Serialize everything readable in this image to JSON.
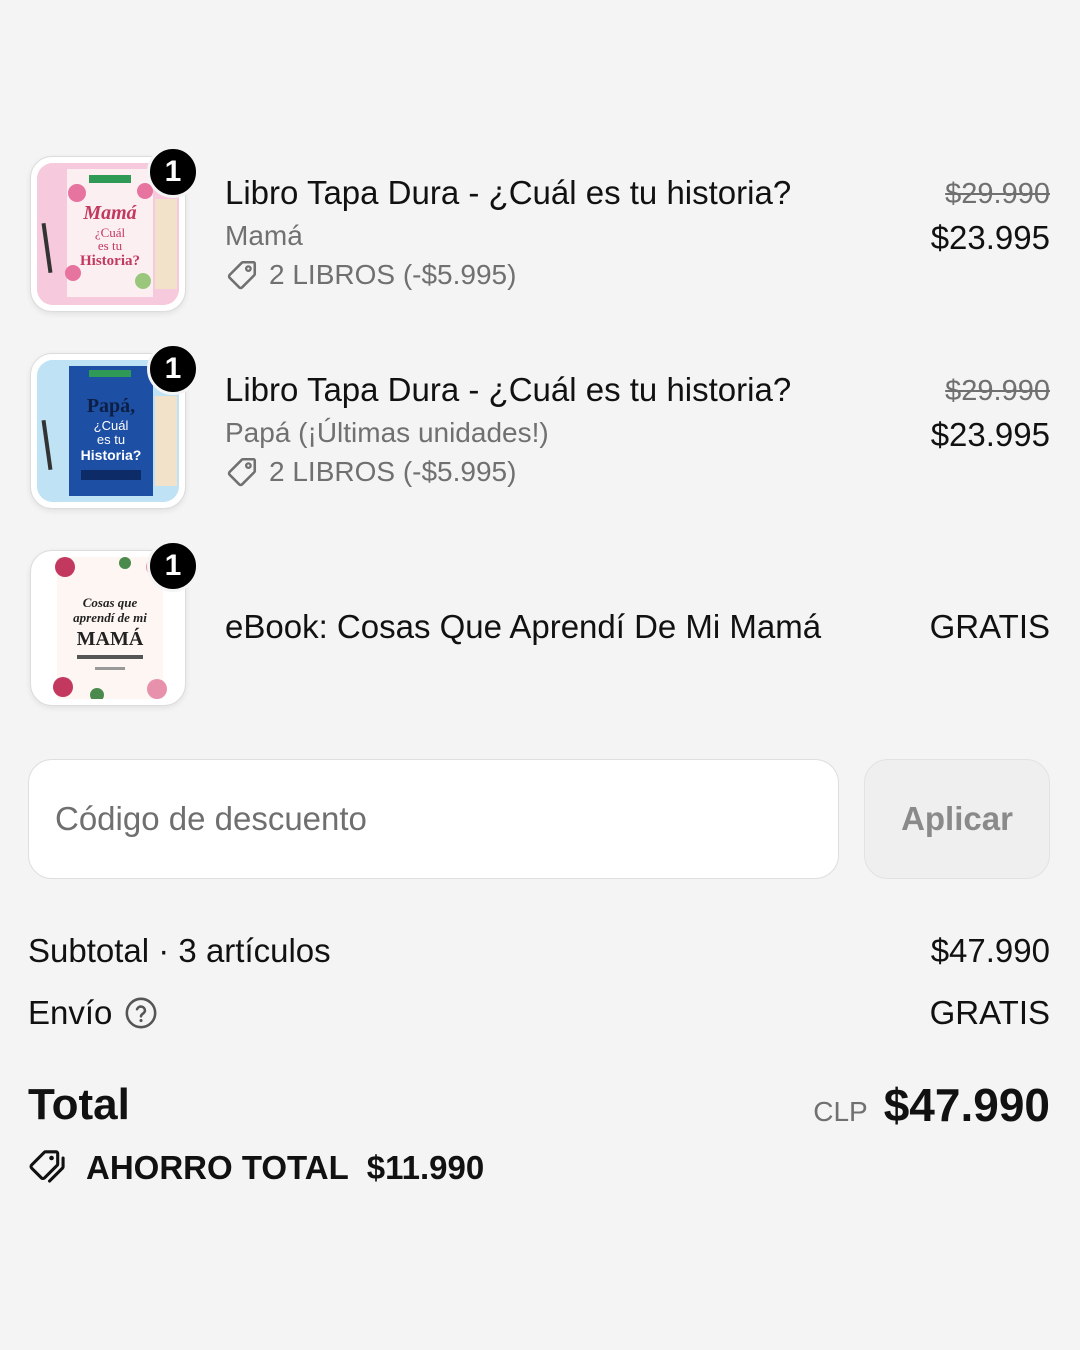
{
  "cart": {
    "items": [
      {
        "quantity": "1",
        "title": "Libro Tapa Dura - ¿Cuál es tu historia?",
        "variant": "Mamá",
        "discount": "2 LIBROS (-$5.995)",
        "price_original": "$29.990",
        "price": "$23.995",
        "thumb_colors": {
          "bg": "#f7c9dc",
          "cover": "#fbeff2",
          "accent": "#d6437f"
        }
      },
      {
        "quantity": "1",
        "title": "Libro Tapa Dura - ¿Cuál es tu historia?",
        "variant": "Papá (¡Últimas unidades!)",
        "discount": "2 LIBROS (-$5.995)",
        "price_original": "$29.990",
        "price": "$23.995",
        "thumb_colors": {
          "bg": "#bfe3f5",
          "cover": "#1d4fa5",
          "accent": "#ffffff"
        }
      },
      {
        "quantity": "1",
        "title": "eBook: Cosas Que Aprendí De Mi Mamá",
        "price": "GRATIS",
        "thumb_colors": {
          "bg": "#ffffff",
          "cover": "#fdf6f3",
          "accent": "#c2385e"
        }
      }
    ]
  },
  "discount": {
    "placeholder": "Código de descuento",
    "apply_label": "Aplicar"
  },
  "summary": {
    "subtotal_label": "Subtotal · 3 artículos",
    "subtotal_value": "$47.990",
    "shipping_label": "Envío",
    "shipping_value": "GRATIS",
    "total_label": "Total",
    "total_currency": "CLP",
    "total_value": "$47.990",
    "savings_label": "AHORRO TOTAL",
    "savings_value": "$11.990"
  },
  "icons": {
    "discount_tag": "tag-icon",
    "shipping_help": "question-circle-icon",
    "savings": "tags-icon"
  }
}
